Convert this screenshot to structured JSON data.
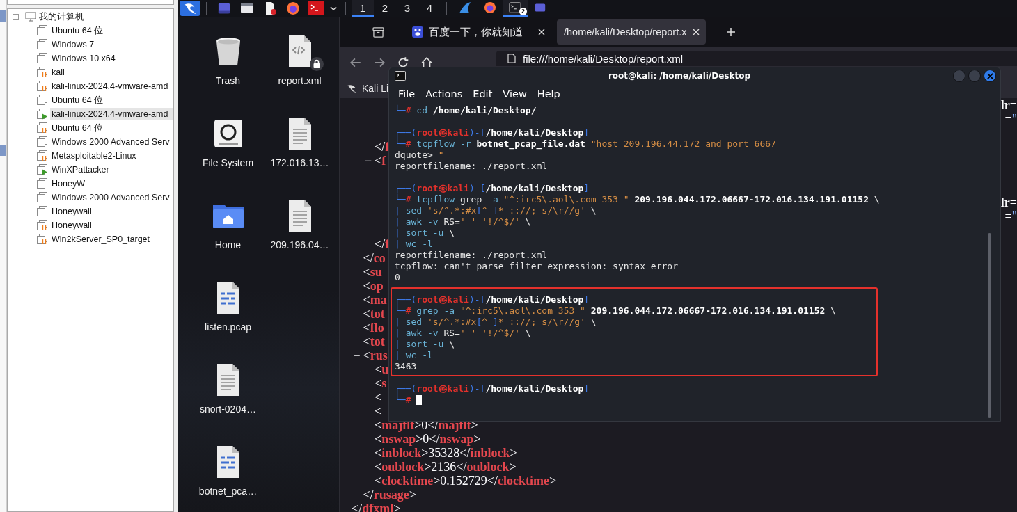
{
  "vm_library": {
    "root": {
      "label": "我的计算机",
      "expanded": true,
      "children": [
        {
          "label": "Ubuntu 64 位",
          "kind": "off",
          "selected": false
        },
        {
          "label": "Windows 7",
          "kind": "off",
          "selected": false
        },
        {
          "label": "Windows 10 x64",
          "kind": "off",
          "selected": false
        },
        {
          "label": "kali",
          "kind": "suspended",
          "selected": false
        },
        {
          "label": "kali-linux-2024.4-vmware-amd",
          "kind": "suspended",
          "selected": false
        },
        {
          "label": "Ubuntu 64 位",
          "kind": "off",
          "selected": false
        },
        {
          "label": "kali-linux-2024.4-vmware-amd",
          "kind": "running",
          "selected": true
        },
        {
          "label": "Ubuntu 64 位",
          "kind": "suspended",
          "selected": false
        },
        {
          "label": "Windows 2000 Advanced Serv",
          "kind": "off",
          "selected": false
        },
        {
          "label": "Metasploitable2-Linux",
          "kind": "suspended",
          "selected": false
        },
        {
          "label": "WinXPattacker",
          "kind": "running",
          "selected": false
        },
        {
          "label": "HoneyW",
          "kind": "off",
          "selected": false
        },
        {
          "label": "Windows 2000 Advanced Serv",
          "kind": "off",
          "selected": false
        },
        {
          "label": "Honeywall",
          "kind": "off",
          "selected": false
        },
        {
          "label": "Honeywall",
          "kind": "suspended",
          "selected": false
        },
        {
          "label": "Win2kServer_SP0_target",
          "kind": "suspended",
          "selected": false
        }
      ]
    }
  },
  "taskbar": {
    "launchers": [
      {
        "kind": "kali-menu"
      },
      {
        "kind": "desktop"
      },
      {
        "kind": "files"
      },
      {
        "kind": "editor"
      },
      {
        "kind": "browser"
      },
      {
        "kind": "terminal"
      },
      {
        "kind": "caret"
      }
    ],
    "workspaces": [
      {
        "label": "1",
        "selected": true
      },
      {
        "label": "2",
        "selected": false
      },
      {
        "label": "3",
        "selected": false
      },
      {
        "label": "4",
        "selected": false
      }
    ],
    "apps": [
      {
        "kind": "fin",
        "selected": false
      },
      {
        "kind": "browser",
        "selected": false
      },
      {
        "kind": "terminal",
        "selected": true,
        "badge": "2"
      },
      {
        "kind": "desktop",
        "selected": false
      }
    ]
  },
  "desktop": {
    "icons": [
      {
        "label": "Trash",
        "kind": "trash",
        "locked": false
      },
      {
        "label": "report.xml",
        "kind": "xml",
        "locked": true
      },
      {
        "label": "File System",
        "kind": "drive",
        "locked": false
      },
      {
        "label": "172.016.13…",
        "kind": "text",
        "locked": false
      },
      {
        "label": "Home",
        "kind": "folder",
        "locked": false
      },
      {
        "label": "209.196.04…",
        "kind": "text",
        "locked": false
      },
      {
        "label": "listen.pcap",
        "kind": "binary",
        "locked": false
      },
      {
        "label": "snort-0204…",
        "kind": "text",
        "locked": false
      },
      {
        "label": "botnet_pca…",
        "kind": "binary",
        "locked": false
      }
    ]
  },
  "browser": {
    "tabs": [
      {
        "label": "百度一下，你就知道",
        "kind": "paw",
        "selected": false
      },
      {
        "label": "/home/kali/Desktop/report.x",
        "kind": "file",
        "selected": true
      }
    ],
    "address": "file:///home/kali/Desktop/report.xml",
    "bookmarks": [
      {
        "label": "Kali Li"
      }
    ],
    "xml": [
      {
        "children": [
          {
            "children": [
              {
                "children": [
                  {
                    "tail": [
                      {
                        "t": "lr",
                        "kind": "attr"
                      },
                      {
                        "t": "=",
                        "kind": "punct"
                      }
                    ]
                  },
                  {
                    "tail": [
                      {
                        "t": "=",
                        "kind": "punct"
                      },
                      {
                        "t": "\"",
                        "kind": "value"
                      }
                    ]
                  },
                  {
                    "kind": "covered"
                  }
                ],
                "close": [
                  {
                    "t": "</",
                    "kind": "punct"
                  },
                  {
                    "t": "f",
                    "kind": "tag"
                  }
                ]
              },
              {
                "toggle": "−",
                "open": [
                  {
                    "t": "<",
                    "kind": "punct"
                  },
                  {
                    "t": "f",
                    "kind": "tag"
                  }
                ],
                "children": [
                  {
                    "kind": "covered"
                  },
                  {
                    "kind": "covered"
                  },
                  {
                    "tail": [
                      {
                        "t": "lr",
                        "kind": "attr"
                      },
                      {
                        "t": "=",
                        "kind": "punct"
                      }
                    ]
                  },
                  {
                    "tail": [
                      {
                        "t": "=",
                        "kind": "punct"
                      },
                      {
                        "t": "\"",
                        "kind": "value"
                      }
                    ]
                  },
                  {
                    "kind": "covered"
                  }
                ],
                "close": [
                  {
                    "t": "</",
                    "kind": "punct"
                  },
                  {
                    "t": "f",
                    "kind": "tag"
                  }
                ]
              }
            ],
            "close": [
              {
                "t": "</",
                "kind": "punct"
              },
              {
                "t": "co",
                "kind": "tag"
              }
            ]
          },
          {
            "open": [
              {
                "t": "<",
                "kind": "punct"
              },
              {
                "t": "su",
                "kind": "tag"
              }
            ]
          },
          {
            "open": [
              {
                "t": "<",
                "kind": "punct"
              },
              {
                "t": "op",
                "kind": "tag"
              }
            ]
          },
          {
            "open": [
              {
                "t": "<",
                "kind": "punct"
              },
              {
                "t": "ma",
                "kind": "tag"
              }
            ]
          },
          {
            "open": [
              {
                "t": "<",
                "kind": "punct"
              },
              {
                "t": "tot",
                "kind": "tag"
              }
            ]
          },
          {
            "open": [
              {
                "t": "<",
                "kind": "punct"
              },
              {
                "t": "flo",
                "kind": "tag"
              }
            ]
          },
          {
            "open": [
              {
                "t": "<",
                "kind": "punct"
              },
              {
                "t": "tot",
                "kind": "tag"
              }
            ]
          },
          {
            "toggle": "−",
            "open": [
              {
                "t": "<",
                "kind": "punct"
              },
              {
                "t": "rus",
                "kind": "tag"
              }
            ],
            "children": [
              {
                "open": [
                  {
                    "t": "<",
                    "kind": "punct"
                  },
                  {
                    "t": "u",
                    "kind": "tag"
                  }
                ]
              },
              {
                "open": [
                  {
                    "t": "<",
                    "kind": "punct"
                  },
                  {
                    "t": "s",
                    "kind": "tag"
                  }
                ]
              },
              {
                "open": [
                  {
                    "t": "<",
                    "kind": "punct"
                  }
                ]
              },
              {
                "open": [
                  {
                    "t": "<",
                    "kind": "punct"
                  }
                ]
              },
              {
                "open": [
                  {
                    "t": "<",
                    "kind": "punct"
                  },
                  {
                    "t": "majflt",
                    "kind": "tag"
                  },
                  {
                    "t": ">0</",
                    "kind": "punct"
                  },
                  {
                    "t": "majflt",
                    "kind": "tag"
                  },
                  {
                    "t": ">",
                    "kind": "punct"
                  }
                ]
              },
              {
                "open": [
                  {
                    "t": "<",
                    "kind": "punct"
                  },
                  {
                    "t": "nswap",
                    "kind": "tag"
                  },
                  {
                    "t": ">0</",
                    "kind": "punct"
                  },
                  {
                    "t": "nswap",
                    "kind": "tag"
                  },
                  {
                    "t": ">",
                    "kind": "punct"
                  }
                ]
              },
              {
                "open": [
                  {
                    "t": "<",
                    "kind": "punct"
                  },
                  {
                    "t": "inblock",
                    "kind": "tag"
                  },
                  {
                    "t": ">35328</",
                    "kind": "punct"
                  },
                  {
                    "t": "inblock",
                    "kind": "tag"
                  },
                  {
                    "t": ">",
                    "kind": "punct"
                  }
                ]
              },
              {
                "open": [
                  {
                    "t": "<",
                    "kind": "punct"
                  },
                  {
                    "t": "oublock",
                    "kind": "tag"
                  },
                  {
                    "t": ">2136</",
                    "kind": "punct"
                  },
                  {
                    "t": "oublock",
                    "kind": "tag"
                  },
                  {
                    "t": ">",
                    "kind": "punct"
                  }
                ]
              },
              {
                "open": [
                  {
                    "t": "<",
                    "kind": "punct"
                  },
                  {
                    "t": "clocktime",
                    "kind": "tag"
                  },
                  {
                    "t": ">0.152729</",
                    "kind": "punct"
                  },
                  {
                    "t": "clocktime",
                    "kind": "tag"
                  },
                  {
                    "t": ">",
                    "kind": "punct"
                  }
                ]
              }
            ],
            "close": [
              {
                "t": "</",
                "kind": "punct"
              },
              {
                "t": "rusage",
                "kind": "tag"
              },
              {
                "t": ">",
                "kind": "punct"
              }
            ]
          }
        ],
        "close": [
          {
            "t": "</",
            "kind": "punct"
          },
          {
            "t": "dfxml",
            "kind": "tag"
          },
          {
            "t": ">",
            "kind": "punct"
          }
        ]
      }
    ]
  },
  "terminal": {
    "title": "root@kali: /home/kali/Desktop",
    "menu": [
      "File",
      "Actions",
      "Edit",
      "View",
      "Help"
    ],
    "blocks": [
      {
        "highlighted": false,
        "lines": [
          {
            "kind": "text",
            "segs": [
              {
                "t": "└─",
                "kind": "frame"
              },
              {
                "t": "# ",
                "kind": "hash"
              },
              {
                "t": "cd ",
                "kind": "cmd"
              },
              {
                "t": "/home/kali/Desktop/",
                "kind": "arg"
              }
            ]
          },
          {
            "kind": "blank"
          },
          {
            "kind": "text",
            "segs": [
              {
                "t": "┌──(",
                "kind": "frame"
              },
              {
                "t": "root㉿kali",
                "kind": "user"
              },
              {
                "t": ")-[",
                "kind": "frame"
              },
              {
                "t": "/home/kali/Desktop",
                "kind": "arg"
              },
              {
                "t": "]",
                "kind": "frame"
              }
            ]
          },
          {
            "kind": "text",
            "segs": [
              {
                "t": "└─",
                "kind": "frame"
              },
              {
                "t": "# ",
                "kind": "hash"
              },
              {
                "t": "tcpflow -r ",
                "kind": "cmd"
              },
              {
                "t": "botnet_pcap_file.dat ",
                "kind": "arg"
              },
              {
                "t": "\"host 209.196.44.172 and port 6667",
                "kind": "str"
              }
            ]
          },
          {
            "kind": "text",
            "segs": [
              {
                "t": "dquote> ",
                "kind": "plain"
              },
              {
                "t": "\"",
                "kind": "str"
              }
            ]
          },
          {
            "kind": "text",
            "segs": [
              {
                "t": "reportfilename: ./report.xml",
                "kind": "plain"
              }
            ]
          },
          {
            "kind": "blank"
          },
          {
            "kind": "text",
            "segs": [
              {
                "t": "┌──(",
                "kind": "frame"
              },
              {
                "t": "root㉿kali",
                "kind": "user"
              },
              {
                "t": ")-[",
                "kind": "frame"
              },
              {
                "t": "/home/kali/Desktop",
                "kind": "arg"
              },
              {
                "t": "]",
                "kind": "frame"
              }
            ]
          },
          {
            "kind": "text",
            "segs": [
              {
                "t": "└─",
                "kind": "frame"
              },
              {
                "t": "# ",
                "kind": "hash"
              },
              {
                "t": "tcpflow ",
                "kind": "cmd"
              },
              {
                "t": "grep ",
                "kind": "plain"
              },
              {
                "t": "-a ",
                "kind": "cmd"
              },
              {
                "t": "\"^:irc5\\.aol\\.com 353 \" ",
                "kind": "str"
              },
              {
                "t": "209.196.044.172.06667-172.016.134.191.01152 ",
                "kind": "arg"
              },
              {
                "t": "\\",
                "kind": "plain"
              }
            ]
          },
          {
            "kind": "text",
            "segs": [
              {
                "t": "| ",
                "kind": "op"
              },
              {
                "t": "sed ",
                "kind": "cmd"
              },
              {
                "t": "'s/^.*:#x",
                "kind": "str"
              },
              {
                "t": "[",
                "kind": "op"
              },
              {
                "t": "^ ",
                "kind": "str"
              },
              {
                "t": "]",
                "kind": "op"
              },
              {
                "t": "* :://; s/\\r//g' ",
                "kind": "str"
              },
              {
                "t": "\\",
                "kind": "plain"
              }
            ]
          },
          {
            "kind": "text",
            "segs": [
              {
                "t": "| ",
                "kind": "op"
              },
              {
                "t": "awk -v ",
                "kind": "cmd"
              },
              {
                "t": "RS=",
                "kind": "plain"
              },
              {
                "t": "' ' '!/^$/' ",
                "kind": "str"
              },
              {
                "t": "\\",
                "kind": "plain"
              }
            ]
          },
          {
            "kind": "text",
            "segs": [
              {
                "t": "| ",
                "kind": "op"
              },
              {
                "t": "sort -u ",
                "kind": "cmd"
              },
              {
                "t": "\\",
                "kind": "plain"
              }
            ]
          },
          {
            "kind": "text",
            "segs": [
              {
                "t": "| ",
                "kind": "op"
              },
              {
                "t": "wc -l",
                "kind": "cmd"
              }
            ]
          },
          {
            "kind": "text",
            "segs": [
              {
                "t": "reportfilename: ./report.xml",
                "kind": "plain"
              }
            ]
          },
          {
            "kind": "text",
            "segs": [
              {
                "t": "tcpflow: can't parse filter expression: syntax error",
                "kind": "plain"
              }
            ]
          },
          {
            "kind": "text",
            "segs": [
              {
                "t": "0",
                "kind": "plain"
              }
            ]
          },
          {
            "kind": "blank"
          }
        ]
      },
      {
        "highlighted": true,
        "lines": [
          {
            "kind": "text",
            "segs": [
              {
                "t": "┌──(",
                "kind": "frame"
              },
              {
                "t": "root㉿kali",
                "kind": "user"
              },
              {
                "t": ")-[",
                "kind": "frame"
              },
              {
                "t": "/home/kali/Desktop",
                "kind": "arg"
              },
              {
                "t": "]",
                "kind": "frame"
              }
            ]
          },
          {
            "kind": "text",
            "segs": [
              {
                "t": "└─",
                "kind": "frame"
              },
              {
                "t": "# ",
                "kind": "hash"
              },
              {
                "t": "grep -a ",
                "kind": "cmd"
              },
              {
                "t": "\"^:irc5\\.aol\\.com 353 \" ",
                "kind": "str"
              },
              {
                "t": "209.196.044.172.06667-172.016.134.191.01152 ",
                "kind": "arg"
              },
              {
                "t": "\\",
                "kind": "plain"
              }
            ]
          },
          {
            "kind": "text",
            "segs": [
              {
                "t": "| ",
                "kind": "op"
              },
              {
                "t": "sed ",
                "kind": "cmd"
              },
              {
                "t": "'s/^.*:#x",
                "kind": "str"
              },
              {
                "t": "[",
                "kind": "op"
              },
              {
                "t": "^ ",
                "kind": "str"
              },
              {
                "t": "]",
                "kind": "op"
              },
              {
                "t": "* :://; s/\\r//g' ",
                "kind": "str"
              },
              {
                "t": "\\",
                "kind": "plain"
              }
            ]
          },
          {
            "kind": "text",
            "segs": [
              {
                "t": "| ",
                "kind": "op"
              },
              {
                "t": "awk -v ",
                "kind": "cmd"
              },
              {
                "t": "RS=",
                "kind": "plain"
              },
              {
                "t": "' ' '!/^$/' ",
                "kind": "str"
              },
              {
                "t": "\\",
                "kind": "plain"
              }
            ]
          },
          {
            "kind": "text",
            "segs": [
              {
                "t": "| ",
                "kind": "op"
              },
              {
                "t": "sort -u ",
                "kind": "cmd"
              },
              {
                "t": "\\",
                "kind": "plain"
              }
            ]
          },
          {
            "kind": "text",
            "segs": [
              {
                "t": "| ",
                "kind": "op"
              },
              {
                "t": "wc -l",
                "kind": "cmd"
              }
            ]
          },
          {
            "kind": "text",
            "segs": [
              {
                "t": "3463",
                "kind": "plain"
              }
            ]
          }
        ]
      },
      {
        "highlighted": false,
        "lines": [
          {
            "kind": "blank"
          },
          {
            "kind": "text",
            "segs": [
              {
                "t": "┌──(",
                "kind": "frame"
              },
              {
                "t": "root㉿kali",
                "kind": "user"
              },
              {
                "t": ")-[",
                "kind": "frame"
              },
              {
                "t": "/home/kali/Desktop",
                "kind": "arg"
              },
              {
                "t": "]",
                "kind": "frame"
              }
            ]
          },
          {
            "kind": "input",
            "segs": [
              {
                "t": "└─",
                "kind": "frame"
              },
              {
                "t": "#",
                "kind": "hash"
              }
            ]
          }
        ]
      }
    ]
  }
}
